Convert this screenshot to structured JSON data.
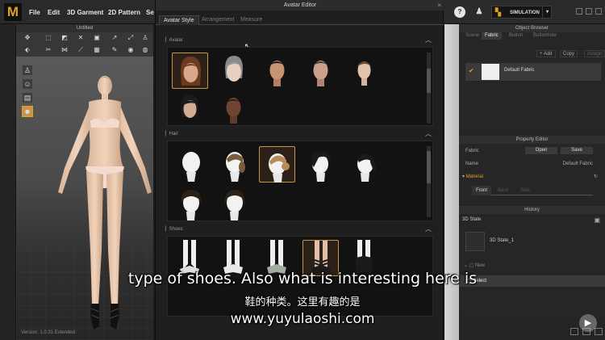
{
  "app": {
    "logo": "M"
  },
  "menu": [
    "File",
    "Edit",
    "3D Garment",
    "2D Pattern",
    "Se"
  ],
  "viewport": {
    "title": "Untitled",
    "version": "Version: 1.0.31   Extended"
  },
  "editor": {
    "title": "Avatar Editor",
    "close": "×",
    "tabs": [
      "Avatar Style",
      "Arrangement",
      "Measure"
    ],
    "sections": {
      "avatar": "Avatar",
      "hair": "Hair",
      "shoes": "Shoes"
    }
  },
  "right": {
    "simulation": "SIMULATION",
    "object_browser": {
      "title": "Object Browser",
      "tabs": [
        "Scene",
        "Fabric",
        "Button",
        "Buttonhole"
      ],
      "actions": [
        "+ Add",
        "Copy",
        "Assign"
      ],
      "item": "Default Fabric"
    },
    "property_editor": {
      "title": "Property Editor",
      "fabric_label": "Fabric",
      "open_btn": "Open",
      "save_btn": "Save",
      "name_label": "Name",
      "name_value": "Default Fabric",
      "material": "Material",
      "sides": [
        "Front",
        "Back",
        "Side"
      ]
    },
    "history": {
      "title": "History",
      "state_title": "3D State",
      "state_item": "3D State_1",
      "new_label": "New",
      "select_label": "Select"
    }
  },
  "subtitles": {
    "en": "type of shoes. Also what is interesting here is",
    "cn": "鞋的种类。这里有趣的是",
    "url": "www.yuyulaoshi.com"
  },
  "colors": {
    "accent": "#e0a020",
    "selection": "#c7954a"
  },
  "icons": {
    "avatar_thumbs": [
      "female-head-icon",
      "male-head-icon",
      "male-head-icon",
      "male-head-icon",
      "female-head-icon",
      "female-head-icon",
      "male-head-icon"
    ],
    "hair_thumbs": [
      "hair-bald-icon",
      "hair-ponytail-icon",
      "hair-bun-icon",
      "hair-short-icon",
      "hair-ponytail-icon",
      "hair-bob-icon",
      "hair-bob-icon"
    ],
    "shoes_thumbs": [
      "shoe-heel-icon",
      "shoe-heel-icon",
      "shoe-sandal-icon",
      "shoe-strap-icon",
      "shoe-boot-icon"
    ]
  }
}
